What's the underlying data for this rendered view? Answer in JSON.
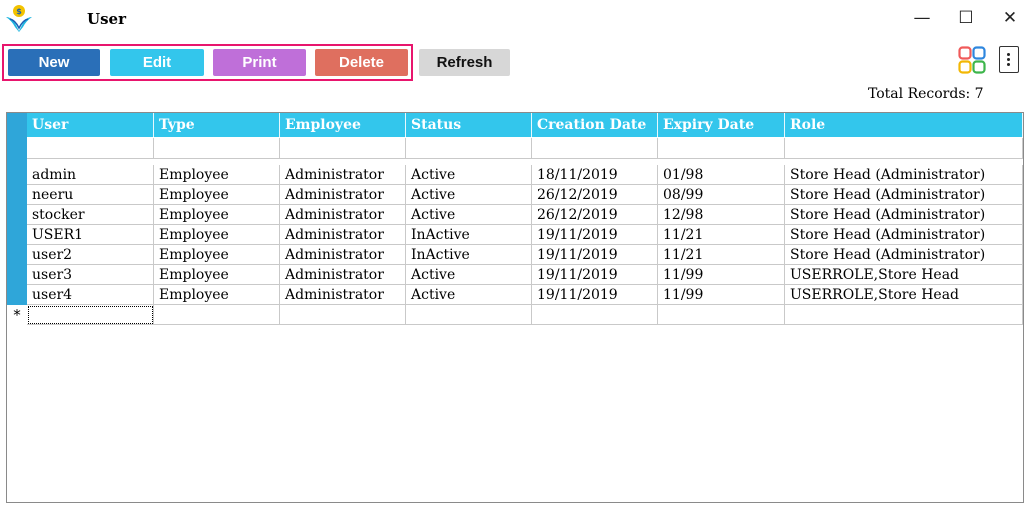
{
  "window": {
    "title": "User",
    "minimize": "—",
    "maximize": "☐",
    "close": "✕"
  },
  "toolbar": {
    "new_label": "New",
    "edit_label": "Edit",
    "print_label": "Print",
    "delete_label": "Delete",
    "refresh_label": "Refresh",
    "colors": {
      "new": "#2a6fb8",
      "edit": "#33c6ec",
      "print": "#bf6fd9",
      "delete": "#df6f5f",
      "refresh": "#d7d7d7",
      "highlight": "#e8156d"
    }
  },
  "icons": {
    "app": "app-logo-icon",
    "layout": "grid-view-icon",
    "more": "more-vertical-icon"
  },
  "summary": {
    "total_records": "Total Records: 7"
  },
  "table": {
    "header_color": "#33c6ec",
    "columns": [
      "User",
      "Type",
      "Employee",
      "Status",
      "Creation Date",
      "Expiry Date",
      "Role"
    ],
    "rows": [
      [
        "admin",
        "Employee",
        "Administrator",
        "Active",
        "18/11/2019",
        "01/98",
        "Store Head (Administrator)"
      ],
      [
        "neeru",
        "Employee",
        "Administrator",
        "Active",
        "26/12/2019",
        "08/99",
        "Store Head (Administrator)"
      ],
      [
        "stocker",
        "Employee",
        "Administrator",
        "Active",
        "26/12/2019",
        "12/98",
        "Store Head (Administrator)"
      ],
      [
        "USER1",
        "Employee",
        "Administrator",
        "InActive",
        "19/11/2019",
        "11/21",
        "Store Head (Administrator)"
      ],
      [
        "user2",
        "Employee",
        "Administrator",
        "InActive",
        "19/11/2019",
        "11/21",
        "Store Head (Administrator)"
      ],
      [
        "user3",
        "Employee",
        "Administrator",
        "Active",
        "19/11/2019",
        "11/99",
        "USERROLE,Store Head"
      ],
      [
        "user4",
        "Employee",
        "Administrator",
        "Active",
        "19/11/2019",
        "11/99",
        "USERROLE,Store Head"
      ]
    ],
    "new_row_marker": "*"
  }
}
